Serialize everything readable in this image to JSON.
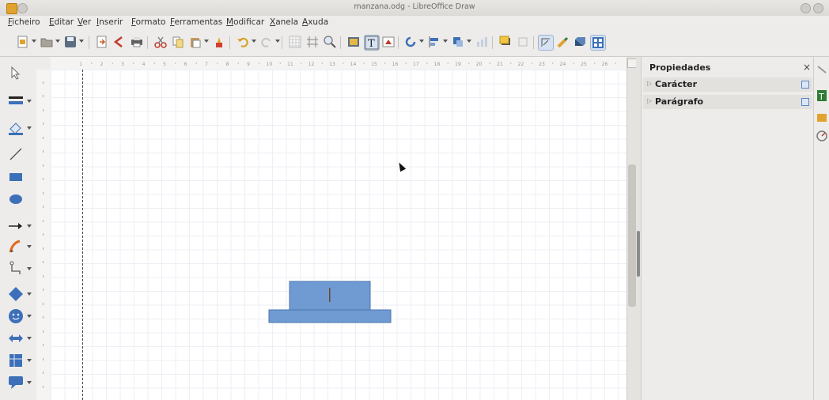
{
  "window": {
    "title": "manzana.odg - LibreOffice Draw"
  },
  "menu": [
    "Ficheiro",
    "Editar",
    "Ver",
    "Inserir",
    "Formato",
    "Ferramentas",
    "Modificar",
    "Xanela",
    "Axuda"
  ],
  "sidebar": {
    "title": "Propiedades",
    "close": "×",
    "sections": [
      {
        "label": "Carácter"
      },
      {
        "label": "Parágrafo"
      }
    ]
  },
  "hruler_labels": [
    "1",
    "2",
    "3",
    "4",
    "5",
    "6",
    "7",
    "8",
    "9",
    "10",
    "11",
    "12",
    "13",
    "14",
    "15",
    "16",
    "17",
    "18",
    "19",
    "20",
    "21",
    "22",
    "23",
    "24",
    "25",
    "26"
  ],
  "colors": {
    "shape_fill": "#6f9bd2",
    "shape_stroke": "#4a74ad",
    "accent": "#5a86c6"
  },
  "icons": [
    "select-arrow-icon",
    "line-color-icon",
    "fill-color-icon",
    "line-icon",
    "rectangle-icon",
    "ellipse-icon",
    "arrow-line-icon",
    "curve-icon",
    "connector-icon",
    "diamond-icon",
    "smiley-icon",
    "double-arrow-icon",
    "flowchart-icon",
    "callout-icon"
  ]
}
